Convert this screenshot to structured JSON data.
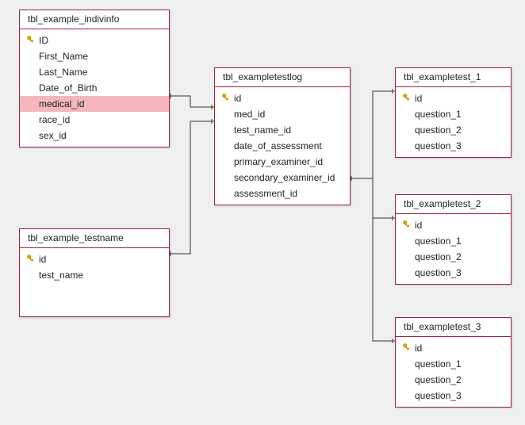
{
  "tables": {
    "indivinfo": {
      "title": "tbl_example_indivinfo",
      "fields": [
        {
          "name": "ID",
          "pk": true
        },
        {
          "name": "First_Name"
        },
        {
          "name": "Last_Name"
        },
        {
          "name": "Date_of_Birth"
        },
        {
          "name": "medical_id",
          "highlight": true
        },
        {
          "name": "race_id"
        },
        {
          "name": "sex_id"
        }
      ]
    },
    "testlog": {
      "title": "tbl_exampletestlog",
      "fields": [
        {
          "name": "id",
          "pk": true
        },
        {
          "name": "med_id"
        },
        {
          "name": "test_name_id"
        },
        {
          "name": "date_of_assessment"
        },
        {
          "name": "primary_examiner_id"
        },
        {
          "name": "secondary_examiner_id"
        },
        {
          "name": "assessment_id"
        }
      ]
    },
    "testname": {
      "title": "tbl_example_testname",
      "fields": [
        {
          "name": "id",
          "pk": true
        },
        {
          "name": "test_name"
        }
      ]
    },
    "et1": {
      "title": "tbl_exampletest_1",
      "fields": [
        {
          "name": "id",
          "pk": true
        },
        {
          "name": "question_1"
        },
        {
          "name": "question_2"
        },
        {
          "name": "question_3"
        }
      ]
    },
    "et2": {
      "title": "tbl_exampletest_2",
      "fields": [
        {
          "name": "id",
          "pk": true
        },
        {
          "name": "question_1"
        },
        {
          "name": "question_2"
        },
        {
          "name": "question_3"
        }
      ]
    },
    "et3": {
      "title": "tbl_exampletest_3",
      "fields": [
        {
          "name": "id",
          "pk": true
        },
        {
          "name": "question_1"
        },
        {
          "name": "question_2"
        },
        {
          "name": "question_3"
        }
      ]
    }
  }
}
